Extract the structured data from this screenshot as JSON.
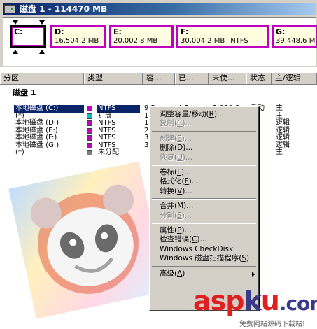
{
  "disk_map": {
    "title": "磁盘 1 - 114470 MB",
    "partitions": [
      {
        "letter": "C:",
        "size": "",
        "fs": "",
        "selected": true
      },
      {
        "letter": "D:",
        "size": "16,504.2 MB",
        "fs": ""
      },
      {
        "letter": "E:",
        "size": "20,002.8 MB",
        "fs": ""
      },
      {
        "letter": "F:",
        "size": "30,004.2 MB",
        "fs": "NTFS"
      },
      {
        "letter": "G:",
        "size": "39,448.6 MB",
        "fs": ""
      }
    ]
  },
  "list": {
    "columns": [
      "分区",
      "类型",
      "容...",
      "已...",
      "未使...",
      "状态",
      "主/逻辑"
    ],
    "group_label": "磁盘 1",
    "rows": [
      {
        "name": "本地磁盘 (C:)",
        "type": "NTFS",
        "cap": "9.5",
        "used": "4.5",
        "unused": "3,050.8",
        "status": "活动",
        "primary": "主",
        "color": "#c000c0",
        "selected": true
      },
      {
        "name": "(*)",
        "type": "扩展",
        "cap": "1",
        "used": "",
        "unused": "",
        "status": "",
        "primary": "主",
        "color": "#00c0c0"
      },
      {
        "name": "本地磁盘 (D:)",
        "type": "NTFS",
        "cap": "1",
        "used": "",
        "unused": "",
        "status": "",
        "primary": "逻辑",
        "color": "#c000c0"
      },
      {
        "name": "本地磁盘 (E:)",
        "type": "NTFS",
        "cap": "2",
        "used": "",
        "unused": "",
        "status": "",
        "primary": "逻辑",
        "color": "#c000c0"
      },
      {
        "name": "本地磁盘 (F:)",
        "type": "NTFS",
        "cap": "3",
        "used": "",
        "unused": "",
        "status": "",
        "primary": "逻辑",
        "color": "#c000c0"
      },
      {
        "name": "本地磁盘 (G:)",
        "type": "NTFS",
        "cap": "3",
        "used": "",
        "unused": "",
        "status": "",
        "primary": "逻辑",
        "color": "#c000c0"
      },
      {
        "name": "(*)",
        "type": "未分配",
        "cap": "",
        "used": "",
        "unused": "",
        "status": "",
        "primary": "主",
        "color": "#808080"
      }
    ]
  },
  "context_menu": {
    "items": [
      {
        "label": "调整容量/移动(",
        "key": "R",
        "suffix": ")...",
        "disabled": false
      },
      {
        "label": "复制(",
        "key": "C",
        "suffix": ")...",
        "disabled": true
      },
      {
        "sep": true
      },
      {
        "label": "创建(",
        "key": "E",
        "suffix": ")...",
        "disabled": true
      },
      {
        "label": "删除(",
        "key": "D",
        "suffix": ")...",
        "disabled": false
      },
      {
        "label": "恢复(",
        "key": "U",
        "suffix": ")...",
        "disabled": true
      },
      {
        "sep": true
      },
      {
        "label": "卷标(",
        "key": "L",
        "suffix": ")...",
        "disabled": false
      },
      {
        "label": "格式化(",
        "key": "F",
        "suffix": ")...",
        "disabled": false
      },
      {
        "label": "转换(",
        "key": "V",
        "suffix": ")...",
        "disabled": false
      },
      {
        "sep": true
      },
      {
        "label": "合并(",
        "key": "M",
        "suffix": ")...",
        "disabled": false
      },
      {
        "label": "分割(",
        "key": "S",
        "suffix": ")...",
        "disabled": true
      },
      {
        "sep": true
      },
      {
        "label": "属性(",
        "key": "P",
        "suffix": ")...",
        "disabled": false
      },
      {
        "label": "检查错误(",
        "key": "C",
        "suffix": ")...",
        "disabled": false
      },
      {
        "label": "Windows CheckDisk",
        "key": "",
        "suffix": "",
        "disabled": false
      },
      {
        "label": "Windows 磁盘扫描程序(",
        "key": "S",
        "suffix": ")",
        "disabled": false
      },
      {
        "sep": true
      },
      {
        "label": "高级(",
        "key": "A",
        "suffix": ")",
        "disabled": false,
        "submenu": true
      }
    ]
  },
  "watermark": {
    "logo_asp": "asp",
    "logo_k": "k",
    "logo_u": "u",
    "logo_com": ".com",
    "tagline": "免费网站源码下载站!"
  },
  "colors": {
    "title_start": "#0a246a",
    "primary_partition": "#c000c0",
    "extended_partition": "#00c0c0",
    "unallocated": "#808080",
    "selection": "#0a246a",
    "logo_red": "#e02020",
    "logo_blue": "#3a3a8a"
  },
  "icons": {
    "disk": "hard-disk-icon"
  }
}
